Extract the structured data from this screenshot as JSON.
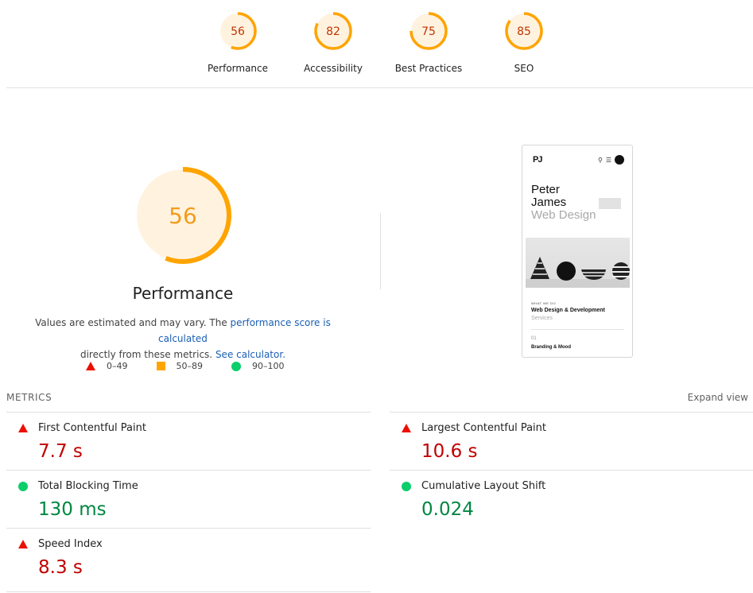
{
  "top_scores": [
    {
      "label": "Performance",
      "score": 56
    },
    {
      "label": "Accessibility",
      "score": 82
    },
    {
      "label": "Best Practices",
      "score": 75
    },
    {
      "label": "SEO",
      "score": 85
    }
  ],
  "hero": {
    "score": 56,
    "title": "Performance",
    "desc_prefix": "Values are estimated and may vary. The ",
    "desc_link1": "performance score is calculated",
    "desc_middle": "directly from these metrics. ",
    "desc_link2": "See calculator.",
    "legend": [
      {
        "range": "0–49",
        "shape": "triangle",
        "color": "#eb0f00"
      },
      {
        "range": "50–89",
        "shape": "square",
        "color": "#ffa400"
      },
      {
        "range": "90–100",
        "shape": "circle",
        "color": "#0cce6b"
      }
    ]
  },
  "screenshot": {
    "logo": "PJ",
    "name_line1": "Peter",
    "name_line2": "James",
    "name_line3": "Web Design",
    "kicker": "WHAT WE DO",
    "heading": "Web Design & Development",
    "sub": "Services",
    "num": "01",
    "item": "Branding & Mood"
  },
  "metrics_section": {
    "header": "METRICS",
    "expand_label": "Expand view",
    "items": [
      {
        "name": "First Contentful Paint",
        "value": "7.7 s",
        "status": "fail"
      },
      {
        "name": "Largest Contentful Paint",
        "value": "10.6 s",
        "status": "fail"
      },
      {
        "name": "Total Blocking Time",
        "value": "130 ms",
        "status": "pass"
      },
      {
        "name": "Cumulative Layout Shift",
        "value": "0.024",
        "status": "pass"
      },
      {
        "name": "Speed Index",
        "value": "8.3 s",
        "status": "fail"
      }
    ]
  },
  "colors": {
    "average_stroke": "#ffa400",
    "average_fill": "#fff3e0",
    "average_text": "#c33300",
    "fail": "#c00000",
    "pass": "#018642"
  }
}
